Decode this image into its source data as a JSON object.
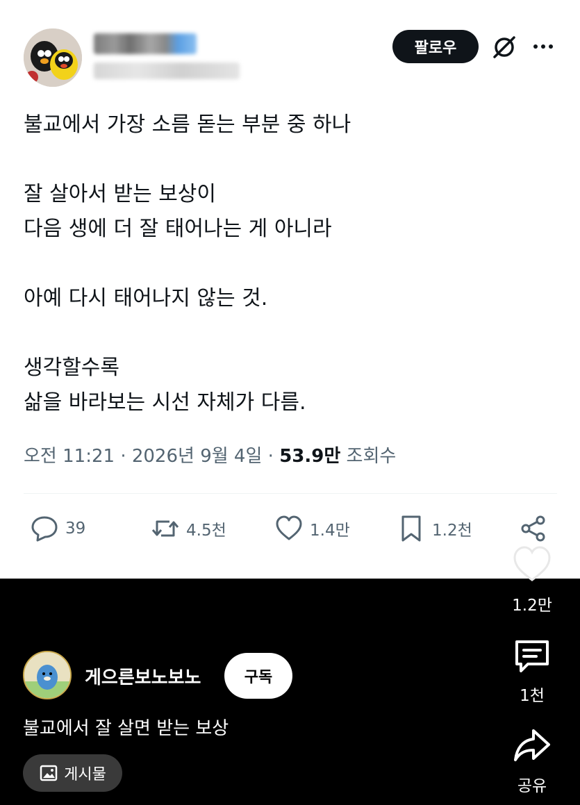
{
  "tweet": {
    "follow_label": "팔로우",
    "icons": [
      "grok-icon",
      "more-icon"
    ],
    "lines": [
      "불교에서 가장 소름 돋는 부분 중 하나",
      "",
      "잘 살아서 받는 보상이",
      "다음 생에 더 잘 태어나는 게 아니라",
      "",
      "아예 다시 태어나지 않는 것.",
      "",
      "생각할수록",
      "삶을 바라보는 시선 자체가 다름."
    ],
    "time": "오전 11:21",
    "sep": "·",
    "date": "2026년 9월 4일",
    "views_value": "53.9만",
    "views_label": "조회수",
    "actions": {
      "reply": "39",
      "retweet": "4.5천",
      "like": "1.4만",
      "bookmark": "1.2천"
    }
  },
  "shorts": {
    "like_count": "1.2만",
    "comment_count": "1천",
    "share_label": "공유",
    "channel_name": "게으른보노보노",
    "subscribe_label": "구독",
    "caption": "불교에서 잘 살면 받는 보상",
    "post_chip_label": "게시물"
  }
}
